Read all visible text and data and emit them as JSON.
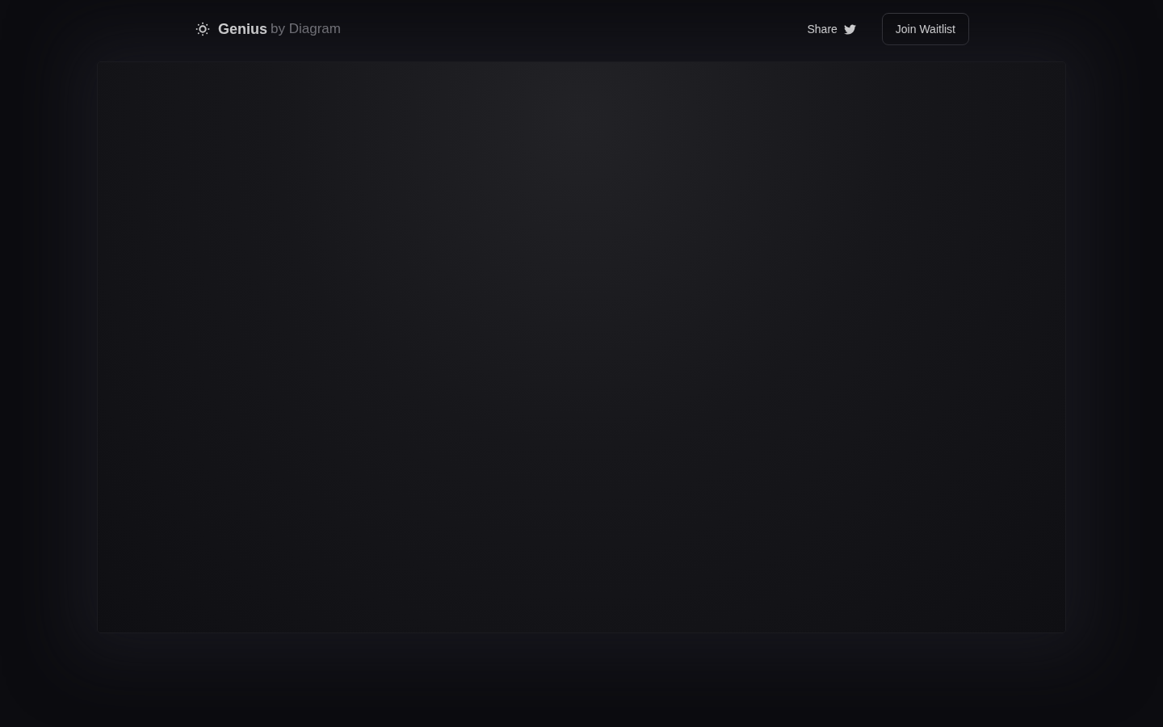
{
  "brand": {
    "name": "Genius",
    "suffix": "by Diagram"
  },
  "nav": {
    "share": "Share",
    "cta": "Join Waitlist"
  }
}
